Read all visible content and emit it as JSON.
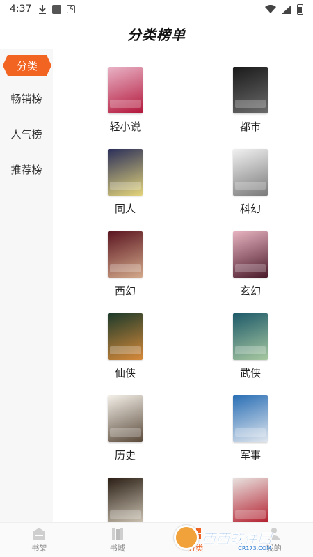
{
  "status": {
    "time": "4:37"
  },
  "header": {
    "title": "分类榜单"
  },
  "sidebar": {
    "items": [
      {
        "label": "分类",
        "active": true
      },
      {
        "label": "畅销榜",
        "active": false
      },
      {
        "label": "人气榜",
        "active": false
      },
      {
        "label": "推荐榜",
        "active": false
      }
    ]
  },
  "categories": [
    {
      "label": "轻小说",
      "colors": [
        "#e9b3c6",
        "#b2163a"
      ]
    },
    {
      "label": "都市",
      "colors": [
        "#1a1a1a",
        "#6b6b6b"
      ]
    },
    {
      "label": "同人",
      "colors": [
        "#2b2f5a",
        "#e3d47a"
      ]
    },
    {
      "label": "科幻",
      "colors": [
        "#f1f1f1",
        "#7a7a7a"
      ]
    },
    {
      "label": "西幻",
      "colors": [
        "#5b1520",
        "#d3a98a"
      ]
    },
    {
      "label": "玄幻",
      "colors": [
        "#e7b3c1",
        "#4a1a2a"
      ]
    },
    {
      "label": "仙侠",
      "colors": [
        "#1c3a2a",
        "#d88a3a"
      ]
    },
    {
      "label": "武侠",
      "colors": [
        "#1e5a6a",
        "#a7c8a0"
      ]
    },
    {
      "label": "历史",
      "colors": [
        "#f3efe8",
        "#5a4a3a"
      ]
    },
    {
      "label": "军事",
      "colors": [
        "#2a6fb5",
        "#e0e6ee"
      ]
    },
    {
      "label": "",
      "colors": [
        "#2a1e14",
        "#cfc6b6"
      ]
    },
    {
      "label": "",
      "colors": [
        "#e8e3e0",
        "#b21a2a"
      ]
    }
  ],
  "tabbar": {
    "items": [
      {
        "label": "书架",
        "icon": "bookshelf-icon",
        "active": false
      },
      {
        "label": "书城",
        "icon": "bookstore-icon",
        "active": false
      },
      {
        "label": "分类",
        "icon": "category-icon",
        "active": true
      },
      {
        "label": "我的",
        "icon": "profile-icon",
        "active": false
      }
    ]
  },
  "watermark": {
    "text": "西西软件园",
    "sub": "CR173.COM"
  },
  "colors": {
    "accent": "#f26422",
    "sidebar_bg": "#f7f7f7"
  }
}
